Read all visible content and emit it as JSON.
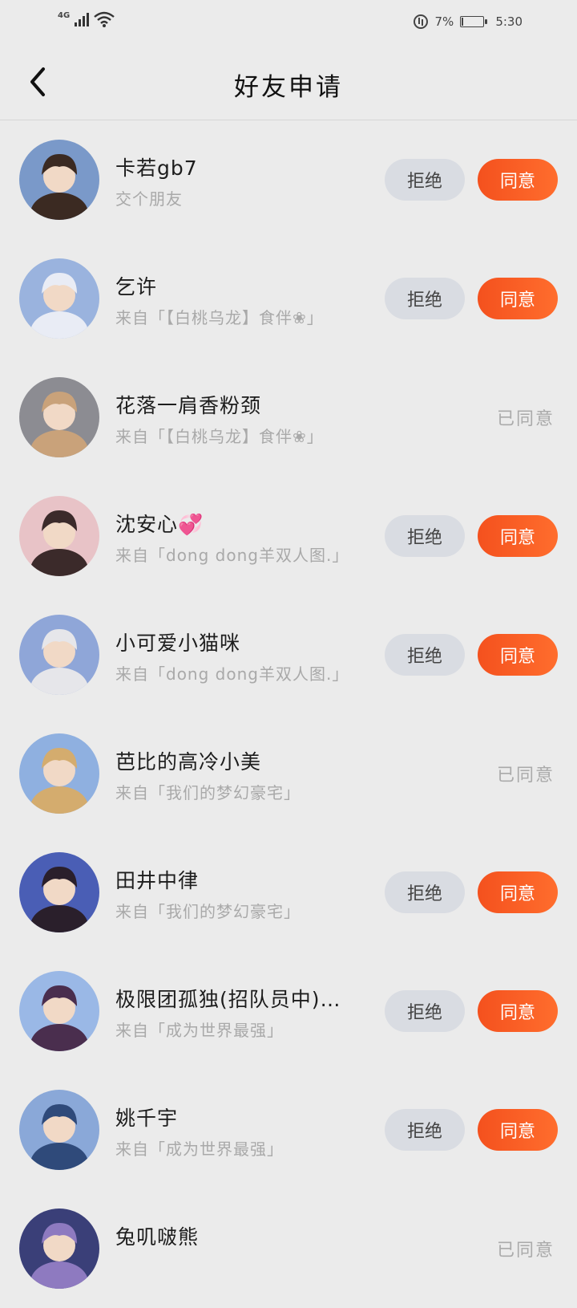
{
  "status": {
    "network": "4G",
    "battery": "7%",
    "time": "5:30",
    "battery_level": 0.07
  },
  "header": {
    "title": "好友申请"
  },
  "buttons": {
    "reject": "拒绝",
    "agree": "同意",
    "agreed": "已同意"
  },
  "requests": [
    {
      "name": "卡若gb7",
      "note": "交个朋友",
      "state": "pending",
      "avatar_bg": "#7a99c9",
      "avatar_fg": "#3b2a22"
    },
    {
      "name": "乞许",
      "note": "来自「【白桃乌龙】食伴❀」",
      "state": "pending",
      "avatar_bg": "#9ab3de",
      "avatar_fg": "#e9ecf5"
    },
    {
      "name": "花落一肩香粉颈",
      "note": "来自「【白桃乌龙】食伴❀」",
      "state": "agreed",
      "avatar_bg": "#8c8c92",
      "avatar_fg": "#c9a27a"
    },
    {
      "name": "沈安心💞",
      "note": "来自「dong dong羊双人图.」",
      "state": "pending",
      "avatar_bg": "#e8c3c7",
      "avatar_fg": "#3b2a2a"
    },
    {
      "name": "小可爱小猫咪",
      "note": "来自「dong dong羊双人图.」",
      "state": "pending",
      "avatar_bg": "#8fa6d8",
      "avatar_fg": "#e6e6ea"
    },
    {
      "name": "芭比的高冷小美",
      "note": "来自「我们的梦幻豪宅」",
      "state": "agreed",
      "avatar_bg": "#8fb0e0",
      "avatar_fg": "#d4ac6e"
    },
    {
      "name": "田井中律",
      "note": "来自「我们的梦幻豪宅」",
      "state": "pending",
      "avatar_bg": "#4a5eb5",
      "avatar_fg": "#2a1f2b"
    },
    {
      "name": "极限团孤独(招队员中)…",
      "note": "来自「成为世界最强」",
      "state": "pending",
      "avatar_bg": "#9ab8e6",
      "avatar_fg": "#4a2e4e"
    },
    {
      "name": "姚千宇",
      "note": "来自「成为世界最强」",
      "state": "pending",
      "avatar_bg": "#8aa8d8",
      "avatar_fg": "#2f4a7a"
    },
    {
      "name": "兔叽啵熊",
      "note": "",
      "state": "agreed",
      "avatar_bg": "#3a3f78",
      "avatar_fg": "#8e7ac0"
    }
  ]
}
